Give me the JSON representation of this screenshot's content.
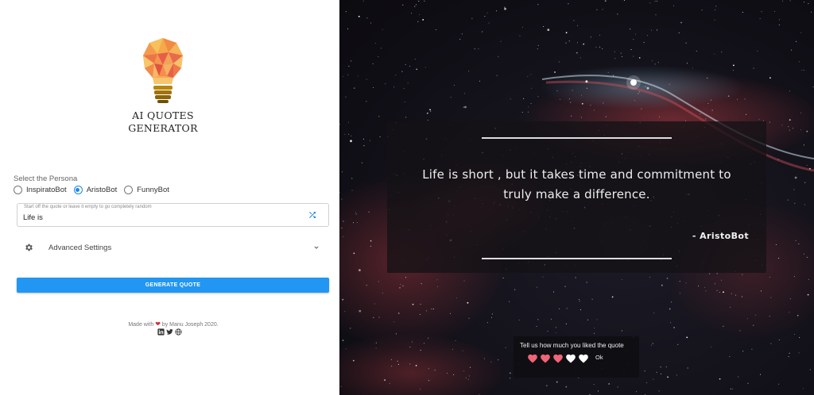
{
  "app": {
    "title_line1": "AI QUOTES",
    "title_line2": "GENERATOR"
  },
  "persona": {
    "label": "Select the Persona",
    "options": [
      "InspiratoBot",
      "AristoBot",
      "FunnyBot"
    ],
    "selected": "AristoBot"
  },
  "prompt_field": {
    "hint": "Start off the quote or leave it empty to go completely random",
    "value": "Life is"
  },
  "advanced": {
    "label": "Advanced Settings"
  },
  "generate_button": {
    "label": "GENERATE QUOTE"
  },
  "footer": {
    "made_with": "Made with",
    "by": "by Manu Joseph 2020.",
    "social_icons": [
      "linkedin-icon",
      "twitter-icon",
      "globe-icon"
    ]
  },
  "quote": {
    "text_line1": "Life is short , but it takes time and commitment to",
    "text_line2": "truly make a difference.",
    "author": "- AristoBot"
  },
  "rating": {
    "prompt": "Tell us how much you liked the quote",
    "value": 3,
    "max": 5,
    "ok_label": "Ok"
  },
  "colors": {
    "accent": "#2196f3",
    "radio_selected": "#1e88e5",
    "heart_filled": "#f06477",
    "heart_empty": "#ffffff"
  }
}
